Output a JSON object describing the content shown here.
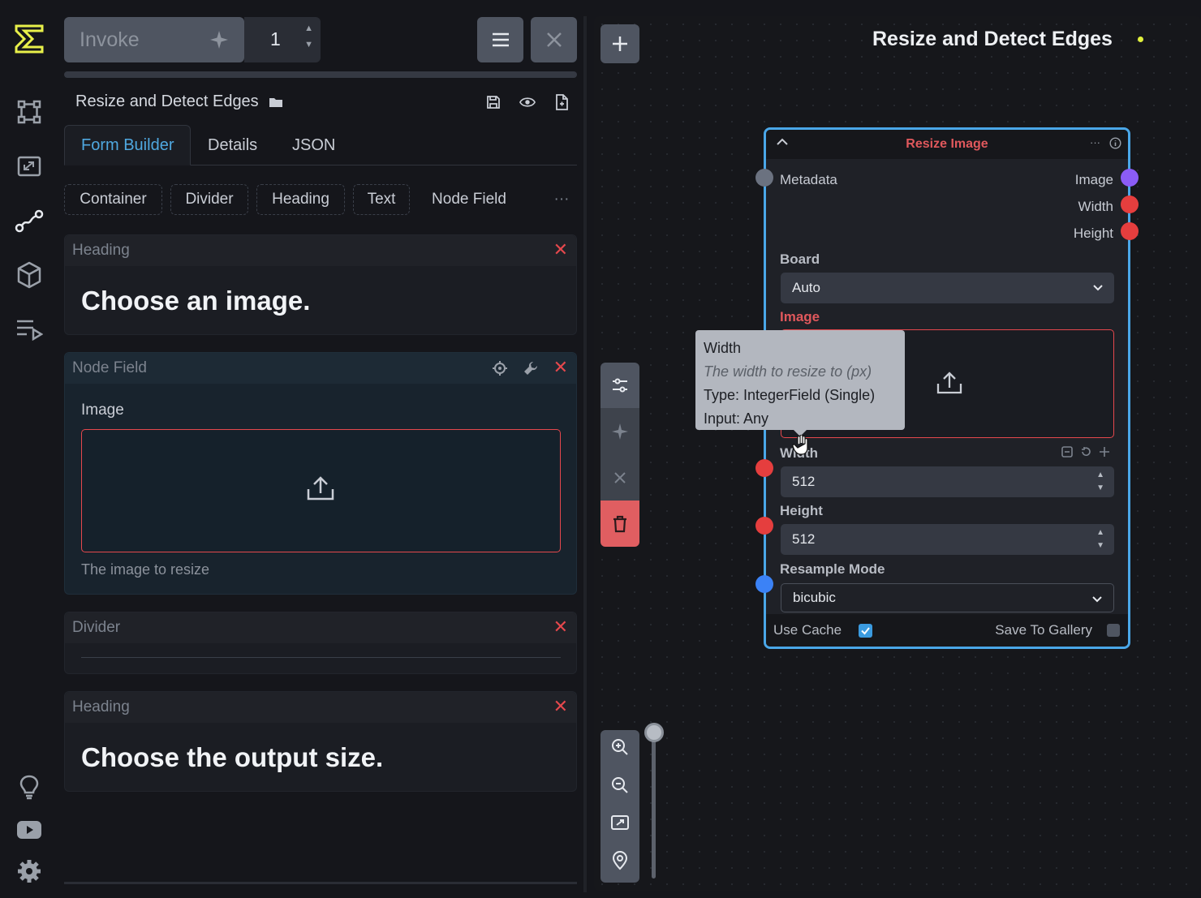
{
  "header": {
    "invoke_label": "Invoke",
    "iterations": "1",
    "workflow_title": "Resize and Detect Edges"
  },
  "tabs": [
    {
      "label": "Form Builder",
      "active": true
    },
    {
      "label": "Details",
      "active": false
    },
    {
      "label": "JSON",
      "active": false
    }
  ],
  "palette": [
    "Container",
    "Divider",
    "Heading",
    "Text",
    "Node Field"
  ],
  "palette_more": "···",
  "form": {
    "heading1": {
      "type_label": "Heading",
      "text": "Choose an image."
    },
    "node_field": {
      "type_label": "Node Field",
      "field_label": "Image",
      "description": "The image to resize"
    },
    "divider": {
      "type_label": "Divider"
    },
    "heading2": {
      "type_label": "Heading",
      "text": "Choose the output size."
    }
  },
  "canvas": {
    "title": "Resize and Detect Edges",
    "status_dot_color": "#e0f03c"
  },
  "node": {
    "title": "Resize Image",
    "inputs_left": [
      "Metadata"
    ],
    "outputs": [
      "Image",
      "Width",
      "Height"
    ],
    "board_label": "Board",
    "board_value": "Auto",
    "image_label": "Image",
    "width_label": "Width",
    "width_value": "512",
    "height_label": "Height",
    "height_value": "512",
    "resample_label": "Resample Mode",
    "resample_value": "bicubic",
    "use_cache_label": "Use Cache",
    "use_cache": true,
    "save_gallery_label": "Save To Gallery",
    "save_gallery": false
  },
  "tooltip": {
    "title": "Width",
    "description": "The width to resize to (px)",
    "type": "Type: IntegerField (Single)",
    "input": "Input: Any"
  },
  "colors": {
    "accent": "#4aa7e8",
    "error": "#e5484d",
    "handle_image": "#8b5cf6",
    "handle_int": "#e53e3e",
    "handle_enum": "#3b82f6",
    "handle_meta": "#6b7280"
  }
}
